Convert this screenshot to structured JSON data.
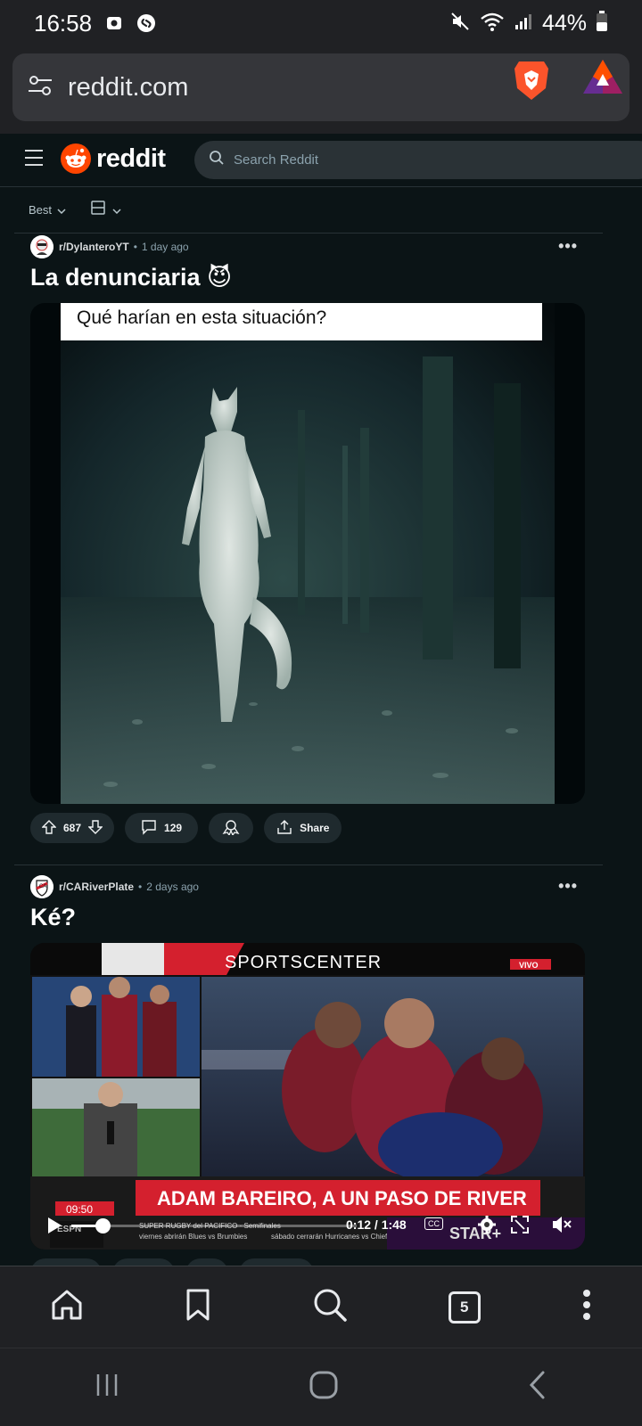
{
  "status_bar": {
    "time": "16:58",
    "battery": "44%"
  },
  "browser": {
    "url": "reddit.com",
    "tab_count": "5"
  },
  "reddit_header": {
    "logo_text": "reddit",
    "search_placeholder": "Search Reddit"
  },
  "sort_bar": {
    "sort_label": "Best"
  },
  "posts": [
    {
      "subreddit": "r/DylanteroYT",
      "age": "1 day ago",
      "title": "La denunciaria 😈",
      "image_caption": "Qué harían en esta situación?",
      "upvotes": "687",
      "comments": "129",
      "share_label": "Share"
    },
    {
      "subreddit": "r/CARiverPlate",
      "age": "2 days ago",
      "title": "Ké?",
      "video": {
        "channel_label": "SPORTSCENTER",
        "live_badge": "VIVO",
        "clock": "09:50",
        "headline": "ADAM BAREIRO, A UN PASO DE RIVER",
        "ticker_top": "SUPER RUGBY del PACIFICO · Semifinales",
        "ticker_left": "viernes abrirán Blues vs Brumbies",
        "ticker_right": "sábado cerrarán Hurricanes vs Chiefs",
        "network": "ESPN",
        "time": "0:12 / 1:48",
        "cc": "CC",
        "progress": 0.11,
        "watermark": "STAR+"
      }
    }
  ],
  "colors": {
    "reddit_orange": "#ff4500",
    "background": "#0b1416",
    "headline_red": "#d4202e"
  }
}
